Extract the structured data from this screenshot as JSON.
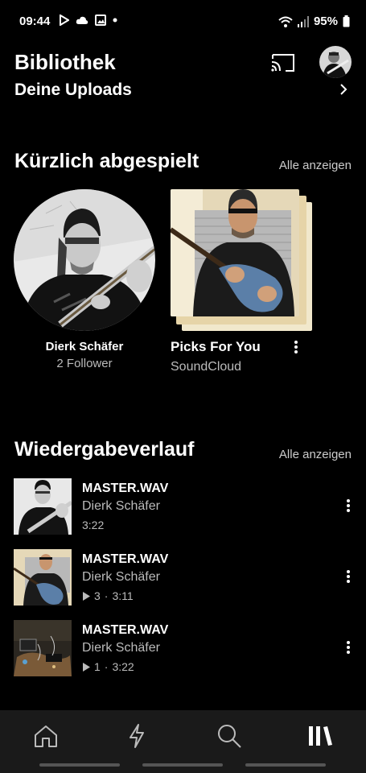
{
  "status_bar": {
    "time": "09:44",
    "battery": "95%"
  },
  "header": {
    "title": "Bibliothek"
  },
  "uploads": {
    "label": "Deine Uploads"
  },
  "recently_played": {
    "title": "Kürzlich abgespielt",
    "see_all": "Alle anzeigen",
    "artist": {
      "name": "Dierk Schäfer",
      "followers": "2 Follower"
    },
    "playlist": {
      "title": "Picks For You",
      "subtitle": "SoundCloud"
    }
  },
  "history": {
    "title": "Wiedergabeverlauf",
    "see_all": "Alle anzeigen",
    "tracks": [
      {
        "title": "MASTER.WAV",
        "artist": "Dierk Schäfer",
        "plays": "",
        "duration": "3:22"
      },
      {
        "title": "MASTER.WAV",
        "artist": "Dierk Schäfer",
        "plays": "3",
        "duration": "3:11"
      },
      {
        "title": "MASTER.WAV",
        "artist": "Dierk Schäfer",
        "plays": "1",
        "duration": "3:22"
      }
    ]
  },
  "bottom_nav": {
    "items": [
      {
        "icon": "home-icon"
      },
      {
        "icon": "lightning-icon"
      },
      {
        "icon": "search-icon"
      },
      {
        "icon": "library-icon",
        "active": true
      }
    ]
  },
  "colors": {
    "background": "#000000",
    "nav_background": "#1a1a1a",
    "secondary_text": "#bbbbbb"
  }
}
